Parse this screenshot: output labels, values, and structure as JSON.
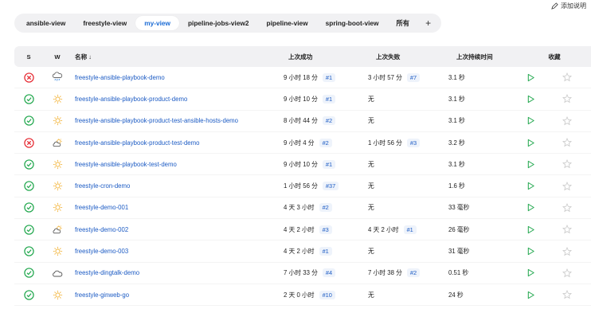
{
  "header": {
    "add_description": "添加说明"
  },
  "tabs": [
    {
      "label": "ansible-view",
      "active": false
    },
    {
      "label": "freestyle-view",
      "active": false
    },
    {
      "label": "my-view",
      "active": true
    },
    {
      "label": "pipeline-jobs-view2",
      "active": false
    },
    {
      "label": "pipeline-view",
      "active": false
    },
    {
      "label": "spring-boot-view",
      "active": false
    },
    {
      "label": "所有",
      "active": false
    },
    {
      "label": "+",
      "active": false
    }
  ],
  "table": {
    "columns": {
      "s": "S",
      "w": "W",
      "name": "名称 ↓",
      "last_success": "上次成功",
      "last_failure": "上次失败",
      "last_duration": "上次持续时间",
      "favorite": "收藏"
    },
    "rows": [
      {
        "status": "failed",
        "weather": "rain-icon",
        "name": "freestyle-ansible-playbook-demo",
        "succ_time": "9 小时 18 分",
        "succ_build": "#1",
        "fail_time": "3 小时 57 分",
        "fail_build": "#7",
        "duration": "3.1 秒"
      },
      {
        "status": "success",
        "weather": "sun-icon",
        "name": "freestyle-ansible-playbook-product-demo",
        "succ_time": "9 小时 10 分",
        "succ_build": "#1",
        "fail_time": "无",
        "fail_build": "",
        "duration": "3.1 秒"
      },
      {
        "status": "success",
        "weather": "sun-icon",
        "name": "freestyle-ansible-playbook-product-test-ansible-hosts-demo",
        "succ_time": "8 小时 44 分",
        "succ_build": "#2",
        "fail_time": "无",
        "fail_build": "",
        "duration": "3.1 秒"
      },
      {
        "status": "failed",
        "weather": "partly-cloudy-icon",
        "name": "freestyle-ansible-playbook-product-test-demo",
        "succ_time": "9 小时 4 分",
        "succ_build": "#2",
        "fail_time": "1 小时 56 分",
        "fail_build": "#3",
        "duration": "3.2 秒"
      },
      {
        "status": "success",
        "weather": "sun-icon",
        "name": "freestyle-ansible-playbook-test-demo",
        "succ_time": "9 小时 10 分",
        "succ_build": "#1",
        "fail_time": "无",
        "fail_build": "",
        "duration": "3.1 秒"
      },
      {
        "status": "success",
        "weather": "sun-icon",
        "name": "freestyle-cron-demo",
        "succ_time": "1 小时 56 分",
        "succ_build": "#37",
        "fail_time": "无",
        "fail_build": "",
        "duration": "1.6 秒"
      },
      {
        "status": "success",
        "weather": "sun-icon",
        "name": "freestyle-demo-001",
        "succ_time": "4 天 3 小时",
        "succ_build": "#2",
        "fail_time": "无",
        "fail_build": "",
        "duration": "33 毫秒"
      },
      {
        "status": "success",
        "weather": "partly-cloudy-icon",
        "name": "freestyle-demo-002",
        "succ_time": "4 天 2 小时",
        "succ_build": "#3",
        "fail_time": "4 天 2 小时",
        "fail_build": "#1",
        "duration": "26 毫秒"
      },
      {
        "status": "success",
        "weather": "sun-icon",
        "name": "freestyle-demo-003",
        "succ_time": "4 天 2 小时",
        "succ_build": "#1",
        "fail_time": "无",
        "fail_build": "",
        "duration": "31 毫秒"
      },
      {
        "status": "success",
        "weather": "cloud-icon",
        "name": "freestyle-dingtalk-demo",
        "succ_time": "7 小时 33 分",
        "succ_build": "#4",
        "fail_time": "7 小时 38 分",
        "fail_build": "#2",
        "duration": "0.51 秒"
      },
      {
        "status": "success",
        "weather": "sun-icon",
        "name": "freestyle-ginweb-go",
        "succ_time": "2 天 0 小时",
        "succ_build": "#10",
        "fail_time": "无",
        "fail_build": "",
        "duration": "24 秒"
      }
    ]
  },
  "colors": {
    "success": "#1ea64b",
    "failed": "#e5262e",
    "link": "#1c5bc4",
    "run": "#1ea64b",
    "sun": "#f3b43a"
  }
}
